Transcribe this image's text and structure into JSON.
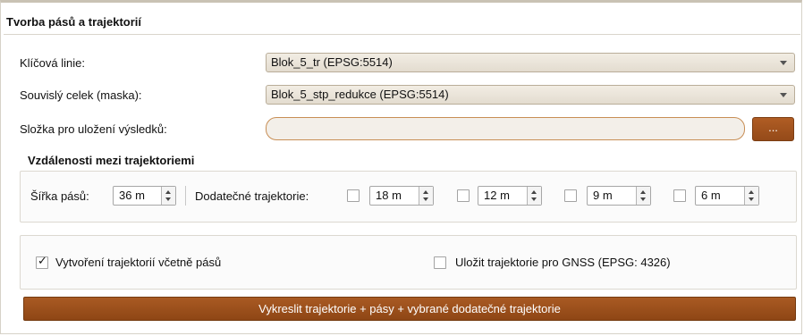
{
  "panel": {
    "title": "Tvorba pásů a trajektorií"
  },
  "key_line": {
    "label": "Klíčová linie:",
    "value": "Blok_5_tr (EPSG:5514)"
  },
  "mask": {
    "label": "Souvislý celek (maska):",
    "value": "Blok_5_stp_redukce (EPSG:5514)"
  },
  "output_folder": {
    "label": "Složka pro uložení výsledků:",
    "value": "",
    "browse_label": "..."
  },
  "distances": {
    "title": "Vzdálenosti mezi trajektoriemi",
    "strip_width_label": "Šířka pásů:",
    "strip_width_value": "36 m",
    "extra_label": "Dodatečné trajektorie:",
    "extra": [
      {
        "checked": false,
        "value": "18 m"
      },
      {
        "checked": false,
        "value": "12 m"
      },
      {
        "checked": false,
        "value": "9 m"
      },
      {
        "checked": false,
        "value": "6 m"
      }
    ]
  },
  "options": {
    "create_with_strips": {
      "label": "Vytvoření trajektorií včetně pásů",
      "checked": true
    },
    "save_gnss": {
      "label": "Uložit trajektorie pro GNSS (EPSG: 4326)",
      "checked": false
    }
  },
  "draw_button": {
    "label": "Vykreslit trajektorie + pásy + vybrané dodatečné trajektorie"
  },
  "colors": {
    "accent": "#9c4f1b",
    "input_border": "#c88e55"
  }
}
